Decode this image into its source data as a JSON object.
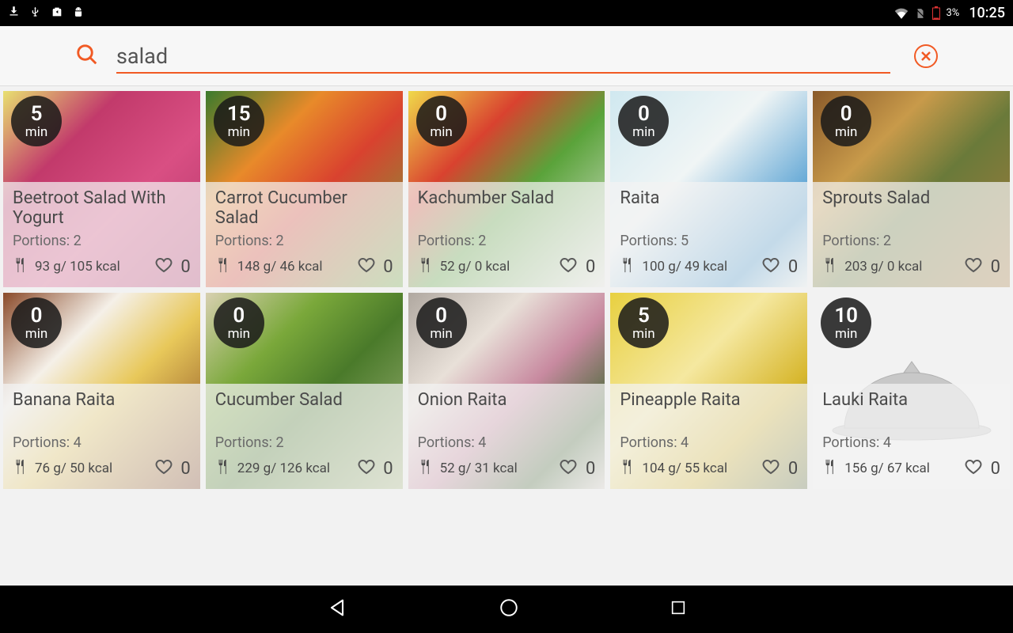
{
  "status": {
    "battery_pct": "3%",
    "time": "10:25"
  },
  "search": {
    "value": "salad"
  },
  "time_unit": "min",
  "portions_label": "Portions: ",
  "cards": [
    {
      "time": "5",
      "title": "Beetroot Salad With Yogurt",
      "portions": "2",
      "nutrition": "93 g/ 105 kcal",
      "fav": "0",
      "bg": "beetroot"
    },
    {
      "time": "15",
      "title": "Carrot Cucumber Salad",
      "portions": "2",
      "nutrition": "148 g/ 46 kcal",
      "fav": "0",
      "bg": "carrotcuke"
    },
    {
      "time": "0",
      "title": "Kachumber Salad",
      "portions": "2",
      "nutrition": "52 g/ 0 kcal",
      "fav": "0",
      "bg": "kachumber"
    },
    {
      "time": "0",
      "title": "Raita",
      "portions": "5",
      "nutrition": "100 g/ 49 kcal",
      "fav": "0",
      "bg": "raita"
    },
    {
      "time": "0",
      "title": "Sprouts Salad",
      "portions": "2",
      "nutrition": "203 g/ 0 kcal",
      "fav": "0",
      "bg": "sprouts"
    },
    {
      "time": "0",
      "title": "Banana Raita",
      "portions": "4",
      "nutrition": "76 g/ 50 kcal",
      "fav": "0",
      "bg": "banana"
    },
    {
      "time": "0",
      "title": "Cucumber Salad",
      "portions": "2",
      "nutrition": "229 g/ 126 kcal",
      "fav": "0",
      "bg": "cuke"
    },
    {
      "time": "0",
      "title": "Onion Raita",
      "portions": "4",
      "nutrition": "52 g/ 31 kcal",
      "fav": "0",
      "bg": "onion"
    },
    {
      "time": "5",
      "title": "Pineapple Raita",
      "portions": "4",
      "nutrition": "104 g/ 55 kcal",
      "fav": "0",
      "bg": "pineapple"
    },
    {
      "time": "10",
      "title": "Lauki Raita",
      "portions": "4",
      "nutrition": "156 g/ 67 kcal",
      "fav": "0",
      "bg": "placeholder"
    }
  ],
  "bg_gradients": {
    "beetroot": "linear-gradient(135deg,#e8e070 0%,#c23a6b 30%,#d94f83 60%,#b2356a 100%)",
    "carrotcuke": "linear-gradient(135deg,#3a7a2d 0%,#e88a2a 30%,#d9422f 55%,#6aa83a 100%)",
    "kachumber": "linear-gradient(135deg,#f0d94a 0%,#d9422f 30%,#5aa33a 55%,#e8e8e0 100%)",
    "raita": "linear-gradient(135deg,#d0e8f0 0%,#f0f5f5 40%,#4a9ad0 80%,#e8f0f0 100%)",
    "sprouts": "linear-gradient(135deg,#8a5a2a 0%,#c89a4a 30%,#6a7a3a 55%,#a87a3a 100%)",
    "banana": "linear-gradient(135deg,#8a4a2a 0%,#f5f0e8 30%,#e8c85a 55%,#7a3a1a 100%)",
    "cuke": "linear-gradient(135deg,#d8d0b0 0%,#7aa83a 30%,#4a7a2a 55%,#a8b880 100%)",
    "onion": "linear-gradient(135deg,#b0a8a0 0%,#e8e0d8 30%,#c88aa0 55%,#4a6a3a 80%,#d8d0c8 100%)",
    "pineapple": "linear-gradient(135deg,#e8d040 0%,#f5e8a0 40%,#d8b830 70%,#5a6a3a 100%)"
  }
}
